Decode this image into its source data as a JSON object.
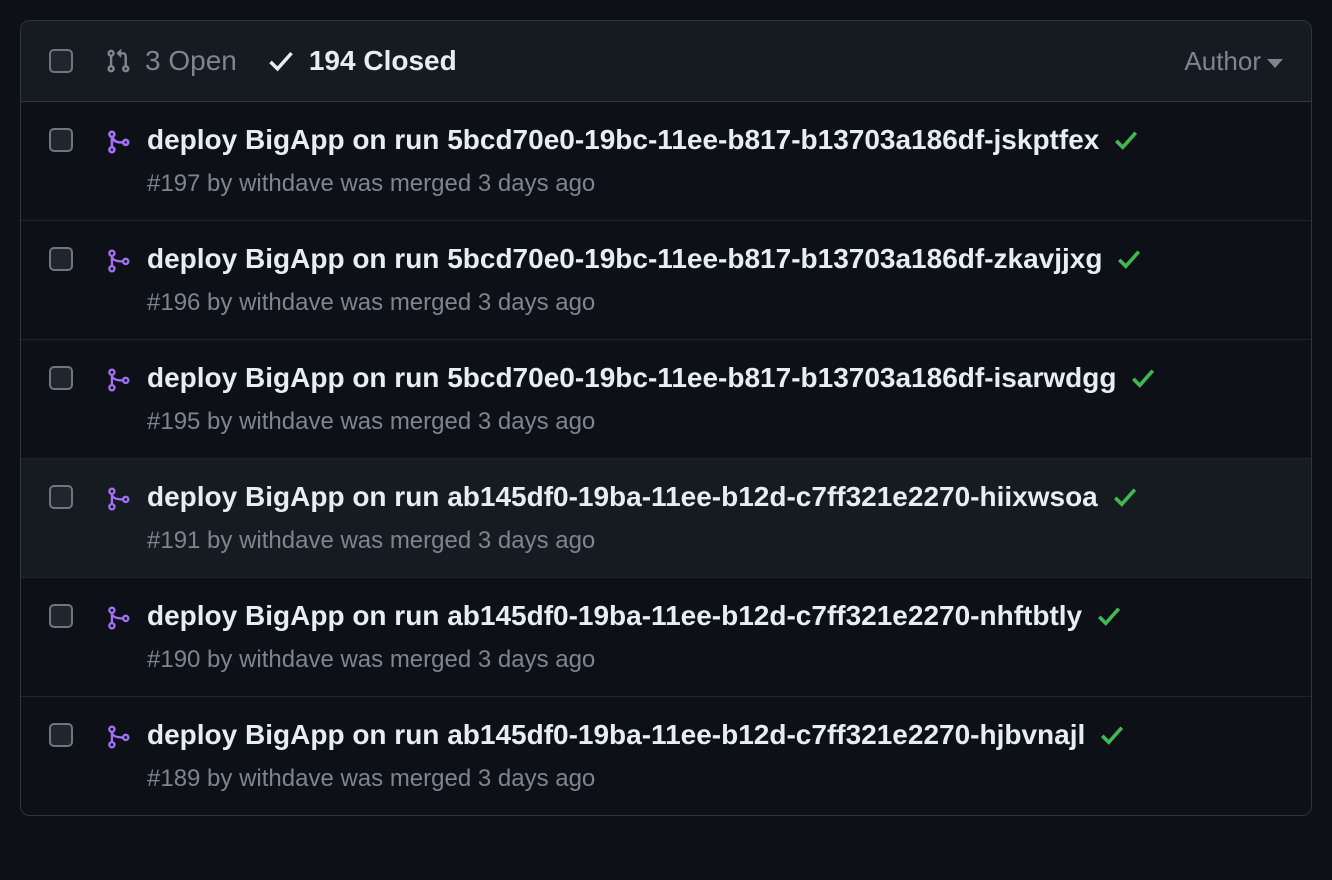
{
  "header": {
    "open_label": "3 Open",
    "closed_label": "194 Closed",
    "author_label": "Author"
  },
  "rows": [
    {
      "title": "deploy BigApp on run 5bcd70e0-19bc-11ee-b817-b13703a186df-jskptfex",
      "meta": "#197 by withdave was merged 3 days ago"
    },
    {
      "title": "deploy BigApp on run 5bcd70e0-19bc-11ee-b817-b13703a186df-zkavjjxg",
      "meta": "#196 by withdave was merged 3 days ago"
    },
    {
      "title": "deploy BigApp on run 5bcd70e0-19bc-11ee-b817-b13703a186df-isarwdgg",
      "meta": "#195 by withdave was merged 3 days ago"
    },
    {
      "title": "deploy BigApp on run ab145df0-19ba-11ee-b12d-c7ff321e2270-hiixwsoa",
      "meta": "#191 by withdave was merged 3 days ago"
    },
    {
      "title": "deploy BigApp on run ab145df0-19ba-11ee-b12d-c7ff321e2270-nhftbtly",
      "meta": "#190 by withdave was merged 3 days ago"
    },
    {
      "title": "deploy BigApp on run ab145df0-19ba-11ee-b12d-c7ff321e2270-hjbvnajl",
      "meta": "#189 by withdave was merged 3 days ago"
    }
  ]
}
